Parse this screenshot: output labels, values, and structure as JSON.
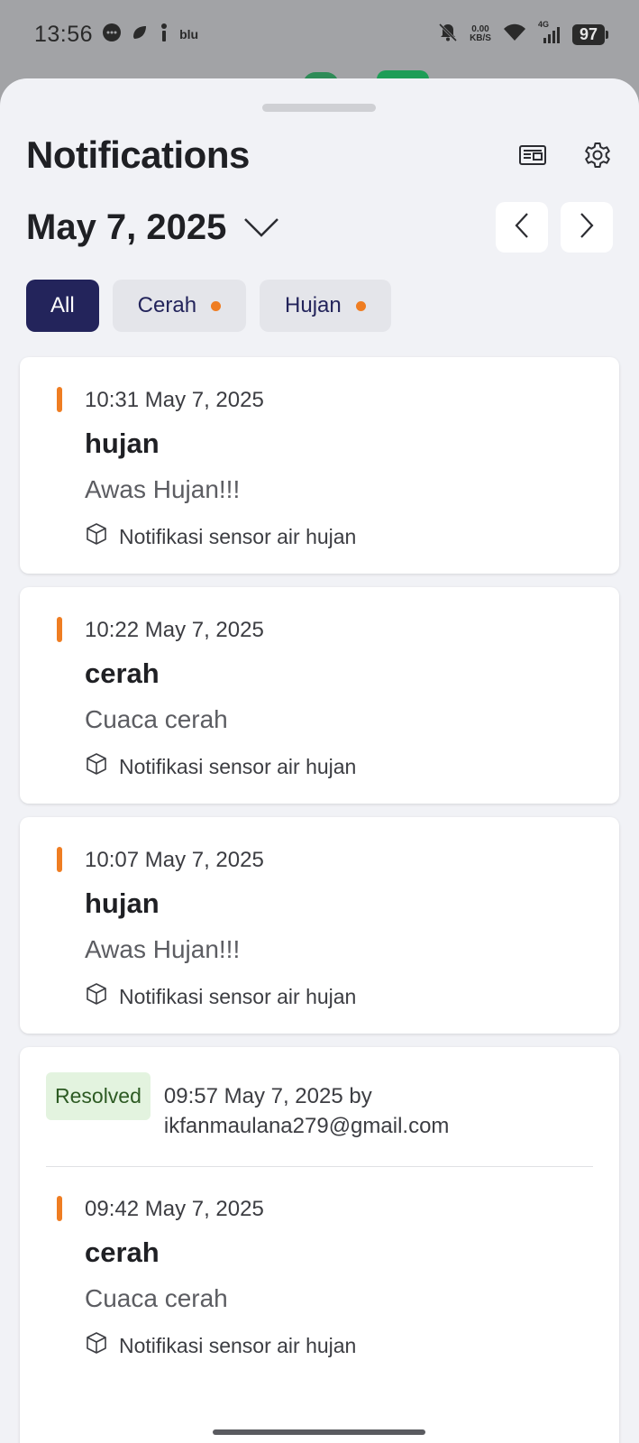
{
  "status_bar": {
    "time": "13:56",
    "carrier_label": "blu",
    "net_speed_value": "0.00",
    "net_speed_unit": "KB/S",
    "network_type": "4G",
    "battery": "97"
  },
  "header": {
    "title": "Notifications",
    "icons": [
      "news-icon",
      "gear-icon"
    ]
  },
  "date_nav": {
    "date": "May 7, 2025"
  },
  "filters": [
    {
      "label": "All",
      "active": true,
      "dot": false
    },
    {
      "label": "Cerah",
      "active": false,
      "dot": true
    },
    {
      "label": "Hujan",
      "active": false,
      "dot": true
    }
  ],
  "notifications": [
    {
      "time": "10:31 May 7, 2025",
      "title": "hujan",
      "message": "Awas Hujan!!!",
      "source": "Notifikasi sensor air hujan"
    },
    {
      "time": "10:22 May 7, 2025",
      "title": "cerah",
      "message": "Cuaca cerah",
      "source": "Notifikasi sensor air hujan"
    },
    {
      "time": "10:07 May 7, 2025",
      "title": "hujan",
      "message": "Awas Hujan!!!",
      "source": "Notifikasi sensor air hujan"
    }
  ],
  "resolved_group": {
    "badge": "Resolved",
    "resolved_text": "09:57 May 7, 2025 by ikfanmaulana279@gmail.com",
    "notification": {
      "time": "09:42 May 7, 2025",
      "title": "cerah",
      "message": "Cuaca cerah",
      "source": "Notifikasi sensor air hujan"
    }
  },
  "colors": {
    "accent_orange": "#ef7d22",
    "chip_active": "#23245b",
    "resolved_bg": "#e3f3df"
  }
}
